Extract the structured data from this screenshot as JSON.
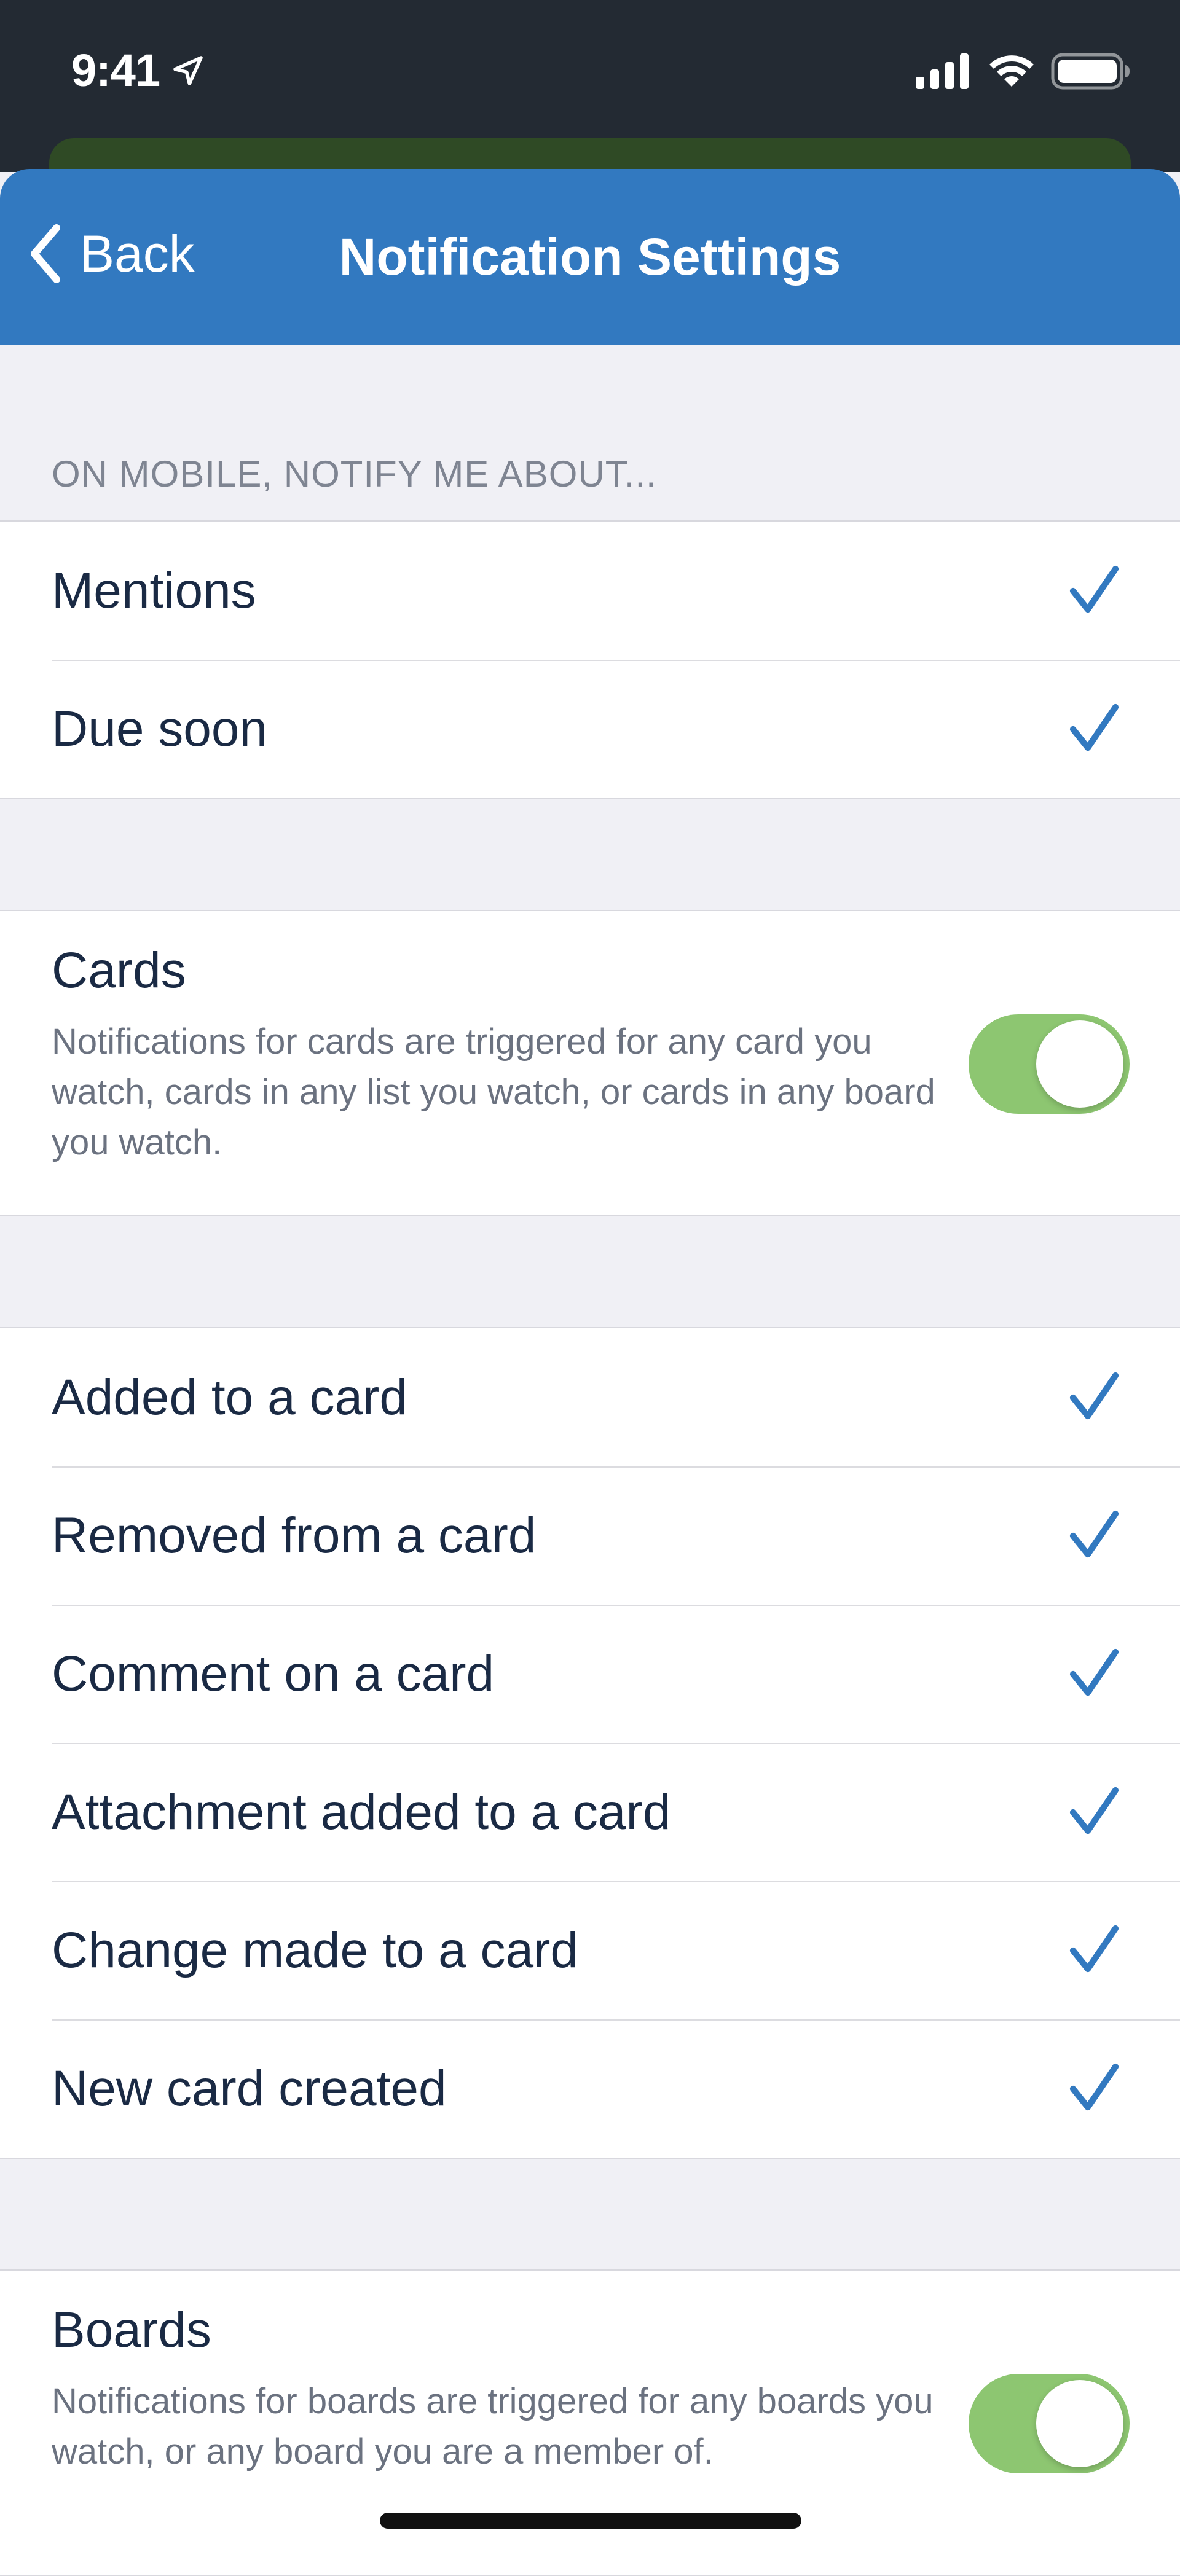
{
  "status_bar": {
    "time": "9:41"
  },
  "nav": {
    "back_label": "Back",
    "title": "Notification Settings"
  },
  "section_header": "ON MOBILE, NOTIFY ME ABOUT...",
  "group1": [
    {
      "label": "Mentions",
      "checked": true
    },
    {
      "label": "Due soon",
      "checked": true
    }
  ],
  "cards": {
    "title": "Cards",
    "description": "Notifications for cards are triggered for any card you watch, cards in any list you watch, or cards in any board you watch.",
    "enabled": true
  },
  "card_events": [
    {
      "label": "Added to a card",
      "checked": true
    },
    {
      "label": "Removed from a card",
      "checked": true
    },
    {
      "label": "Comment on a card",
      "checked": true
    },
    {
      "label": "Attachment added to a card",
      "checked": true
    },
    {
      "label": "Change made to a card",
      "checked": true
    },
    {
      "label": "New card created",
      "checked": true
    }
  ],
  "boards": {
    "title": "Boards",
    "description": "Notifications for boards are triggered for any boards you watch, or any board you are a member of.",
    "enabled": true
  },
  "colors": {
    "nav_bar": "#3279c0",
    "check": "#3279c0",
    "toggle_on": "#8dc671",
    "status_bar": "#232a33"
  }
}
